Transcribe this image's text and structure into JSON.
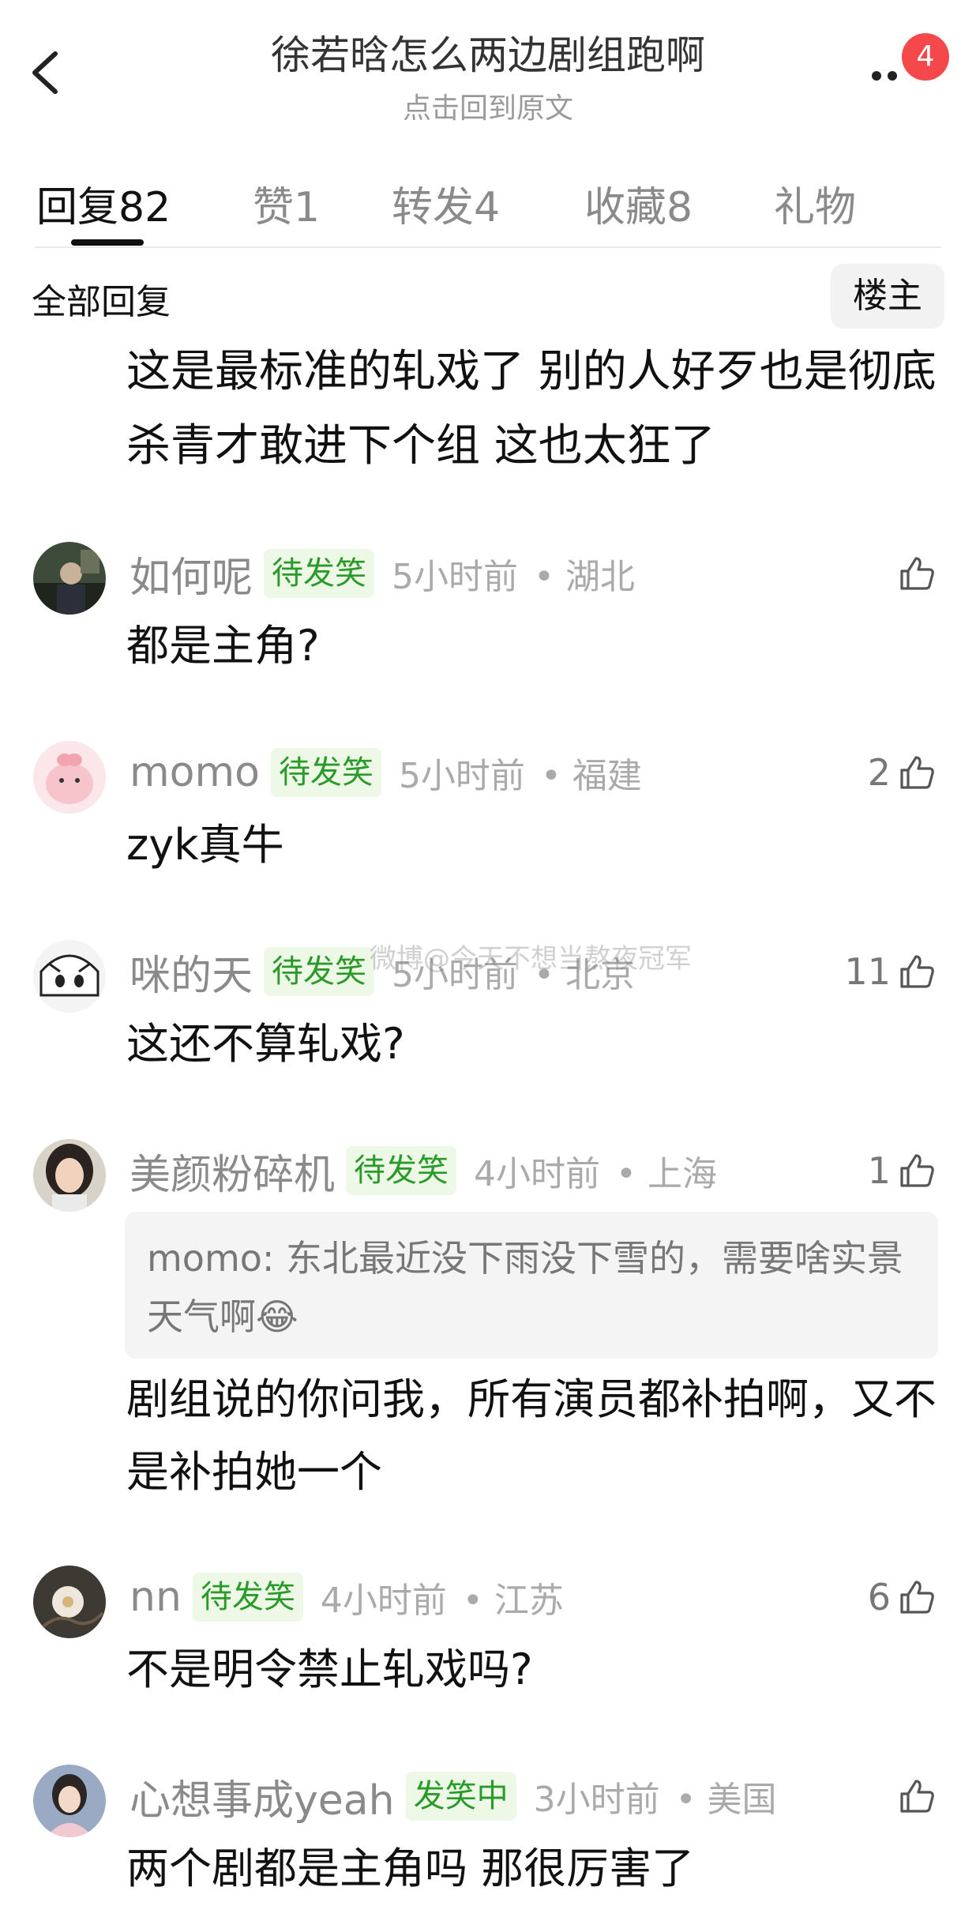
{
  "header": {
    "title": "徐若晗怎么两边剧组跑啊",
    "subtitle": "点击回到原文",
    "badge_count": "4"
  },
  "tabs": [
    {
      "label": "回复",
      "count": "82"
    },
    {
      "label": "赞",
      "count": "1"
    },
    {
      "label": "转发",
      "count": "4"
    },
    {
      "label": "收藏",
      "count": "8"
    },
    {
      "label": "礼物",
      "count": ""
    }
  ],
  "filter": {
    "label": "全部回复",
    "op_button": "楼主"
  },
  "op_reply": {
    "text": "这是最标准的轧戏了 别的人好歹也是彻底杀青才敢进下个组 这也太狂了"
  },
  "comments": [
    {
      "username": "如何呢",
      "tag": "待发笑",
      "time": "5小时前",
      "location": "• 湖北",
      "likes": "",
      "text": "都是主角?"
    },
    {
      "username": "momo",
      "tag": "待发笑",
      "time": "5小时前",
      "location": "• 福建",
      "likes": "2",
      "text": "zyk真牛"
    },
    {
      "username": "咪的天",
      "tag": "待发笑",
      "time": "5小时前",
      "location": "• 北京",
      "likes": "11",
      "text": "这还不算轧戏?"
    },
    {
      "username": "美颜粉碎机",
      "tag": "待发笑",
      "time": "4小时前",
      "location": "• 上海",
      "likes": "1",
      "text": "剧组说的你问我，所有演员都补拍啊，又不是补拍她一个",
      "quote": "momo: 东北最近没下雨没下雪的，需要啥实景天气啊😂"
    },
    {
      "username": "nn",
      "tag": "待发笑",
      "time": "4小时前",
      "location": "• 江苏",
      "likes": "6",
      "text": "不是明令禁止轧戏吗?"
    },
    {
      "username": "心想事成yeah",
      "tag": "发笑中",
      "time": "3小时前",
      "location": "• 美国",
      "likes": "",
      "text": "两个剧都是主角吗 那很厉害了"
    }
  ],
  "watermark": "微博@今天不想当熬夜冠军",
  "colors": {
    "tag_bg": "#eef8e6",
    "tag_text": "#2a9b2a",
    "badge": "#f5484b",
    "meta_gray": "#aaaaaa"
  },
  "icons": {
    "back": "chevron-left-icon",
    "more": "more-dots-icon",
    "like": "thumbs-up-icon"
  }
}
